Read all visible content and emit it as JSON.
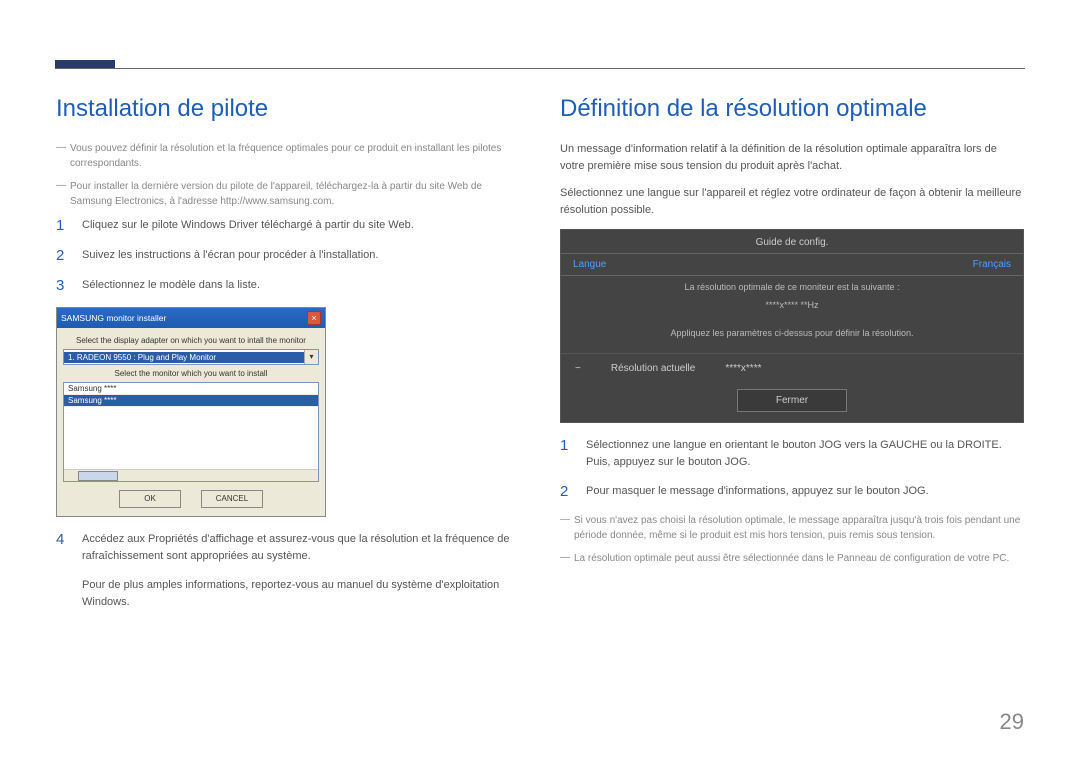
{
  "page_number": "29",
  "left": {
    "heading": "Installation de pilote",
    "notes": [
      "Vous pouvez définir la résolution et la fréquence optimales pour ce produit en installant les pilotes correspondants.",
      "Pour installer la dernière version du pilote de l'appareil, téléchargez-la à partir du site Web de Samsung Electronics, à l'adresse http://www.samsung.com."
    ],
    "steps": [
      {
        "n": "1",
        "t": "Cliquez sur le pilote Windows Driver téléchargé à partir du site Web."
      },
      {
        "n": "2",
        "t": "Suivez les instructions à l'écran pour procéder à l'installation."
      },
      {
        "n": "3",
        "t": "Sélectionnez le modèle dans la liste."
      },
      {
        "n": "4",
        "t": "Accédez aux Propriétés d'affichage et assurez-vous que la résolution et la fréquence de rafraîchissement sont appropriées au système."
      }
    ],
    "closing": "Pour de plus amples informations, reportez-vous au manuel du système d'exploitation Windows.",
    "dialog": {
      "title": "SAMSUNG monitor installer",
      "label1": "Select the display adapter on which you want to intall the monitor",
      "selected": "1. RADEON 9550 : Plug and Play Monitor",
      "label2": "Select the monitor which you want to install",
      "list": [
        "Samsung ****",
        "Samsung ****"
      ],
      "ok": "OK",
      "cancel": "CANCEL"
    }
  },
  "right": {
    "heading": "Définition de la résolution optimale",
    "intro1": "Un message d'information relatif à la définition de la résolution optimale apparaîtra lors de votre première mise sous tension du produit après l'achat.",
    "intro2": "Sélectionnez une langue sur l'appareil et réglez votre ordinateur de façon à obtenir la meilleure résolution possible.",
    "osd": {
      "title": "Guide de config.",
      "lang_label": "Langue",
      "lang_value": "Français",
      "line1": "La résolution optimale de ce moniteur est la suivante :",
      "line2": "****x**** **Hz",
      "line3": "Appliquez les paramètres ci-dessus pour définir la résolution.",
      "res_label": "Résolution actuelle",
      "res_value": "****x****",
      "close": "Fermer"
    },
    "steps": [
      {
        "n": "1",
        "t": "Sélectionnez une langue en orientant le bouton JOG vers la GAUCHE ou la DROITE. Puis, appuyez sur le bouton JOG."
      },
      {
        "n": "2",
        "t": "Pour masquer le message d'informations, appuyez sur le bouton JOG."
      }
    ],
    "notes": [
      "Si vous n'avez pas choisi la résolution optimale, le message apparaîtra jusqu'à trois fois pendant une période donnée, même si le produit est mis hors tension, puis remis sous tension.",
      "La résolution optimale peut aussi être sélectionnée dans le Panneau de configuration de votre PC."
    ]
  }
}
